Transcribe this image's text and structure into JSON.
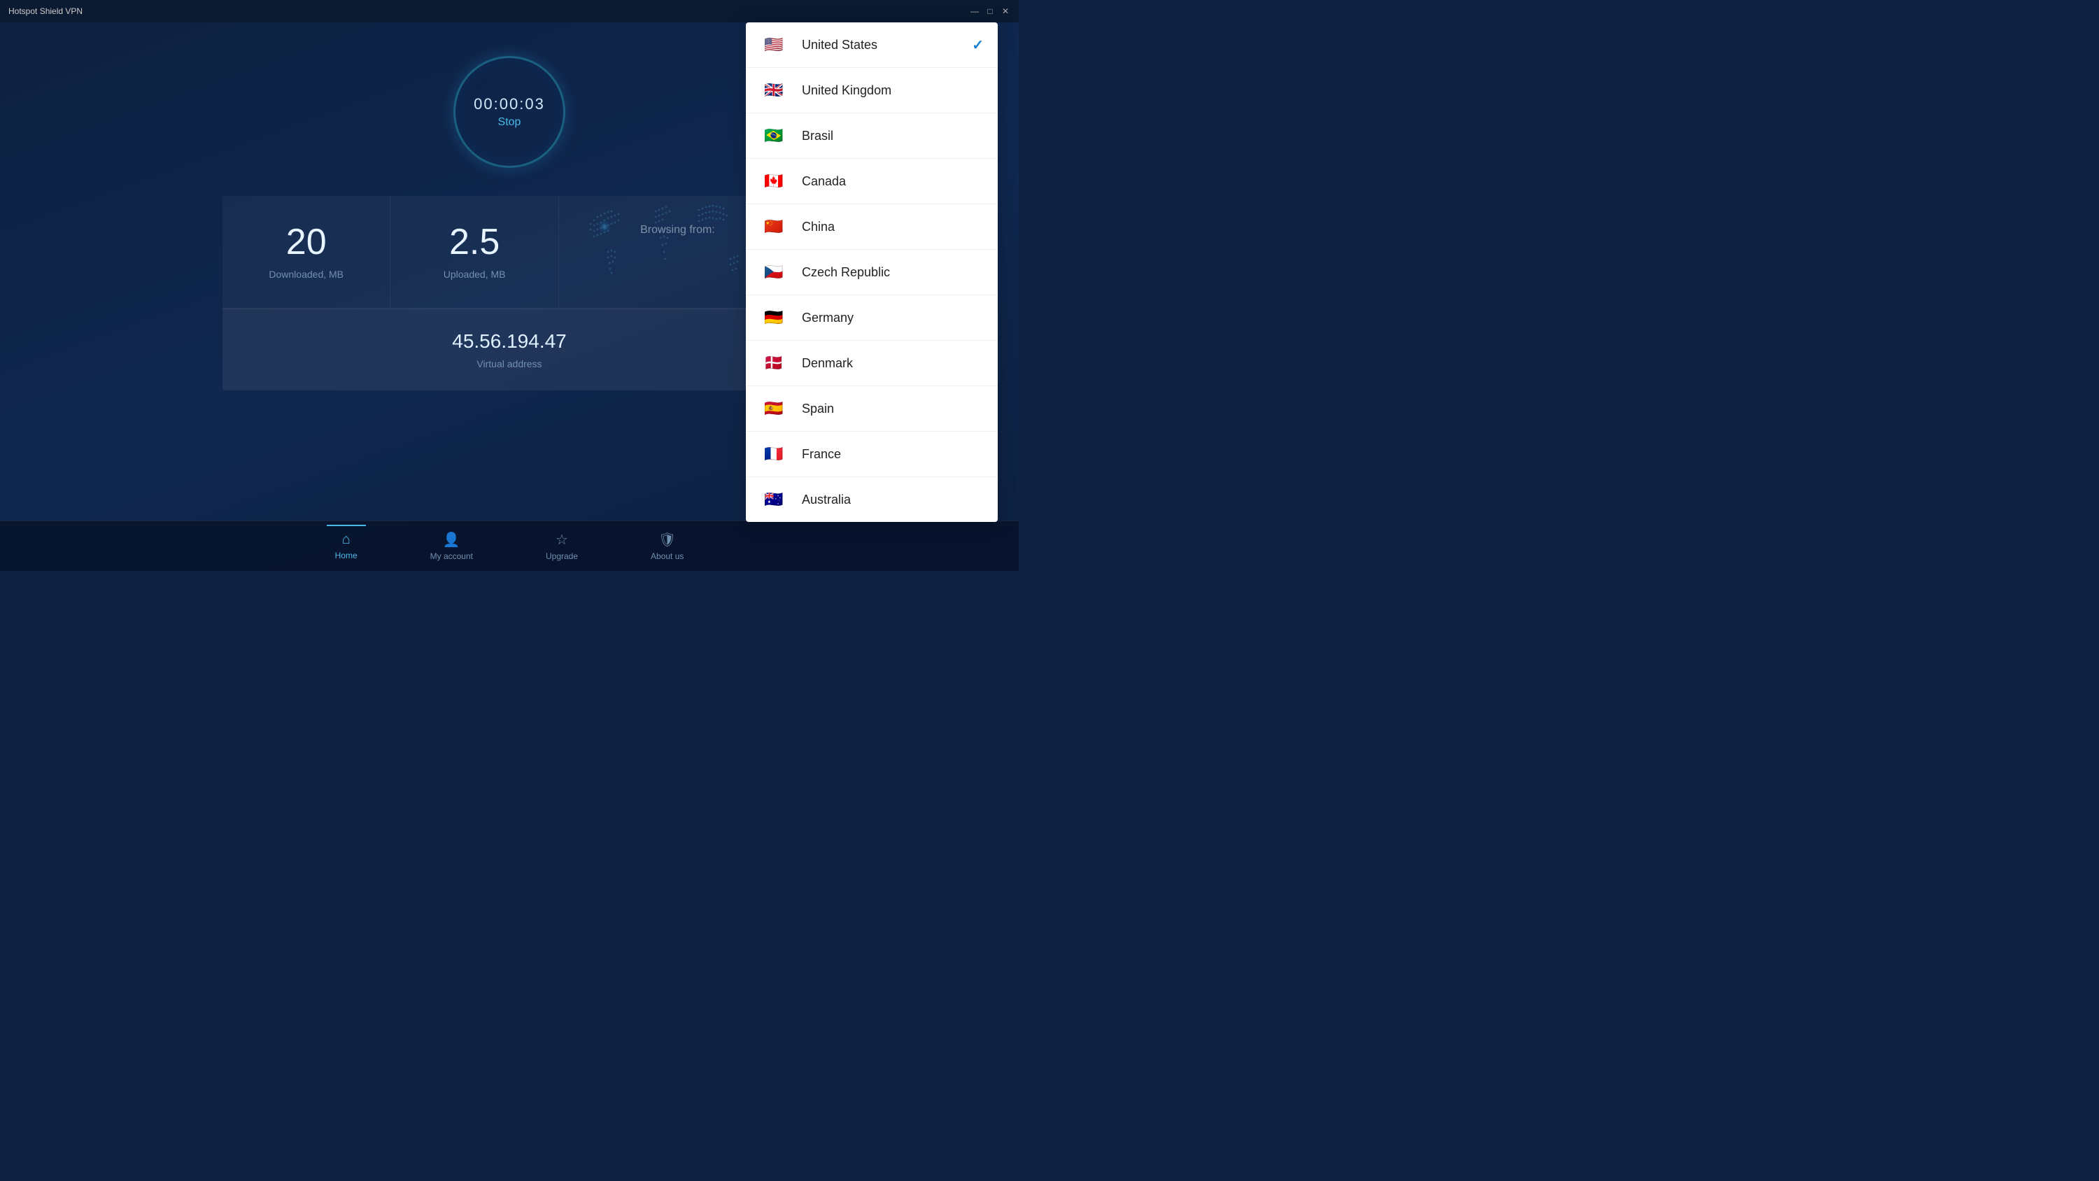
{
  "app": {
    "title": "Hotspot Shield VPN"
  },
  "titlebar": {
    "minimize": "—",
    "maximize": "□",
    "close": "✕"
  },
  "timer": {
    "value": "00:00:03",
    "stop_label": "Stop"
  },
  "stats": {
    "downloaded_value": "20",
    "downloaded_label": "Downloaded, MB",
    "uploaded_value": "2.5",
    "uploaded_label": "Uploaded, MB"
  },
  "browsing": {
    "label": "Browsing from:"
  },
  "address": {
    "ip": "45.56.194.47",
    "label": "Virtual address"
  },
  "nav": {
    "home_label": "Home",
    "account_label": "My account",
    "upgrade_label": "Upgrade",
    "about_label": "About us"
  },
  "dropdown": {
    "countries": [
      {
        "id": "us",
        "name": "United States",
        "flag": "🇺🇸",
        "selected": true
      },
      {
        "id": "gb",
        "name": "United Kingdom",
        "flag": "🇬🇧",
        "selected": false
      },
      {
        "id": "br",
        "name": "Brasil",
        "flag": "🇧🇷",
        "selected": false
      },
      {
        "id": "ca",
        "name": "Canada",
        "flag": "🇨🇦",
        "selected": false
      },
      {
        "id": "cn",
        "name": "China",
        "flag": "🇨🇳",
        "selected": false
      },
      {
        "id": "cz",
        "name": "Czech Republic",
        "flag": "🇨🇿",
        "selected": false
      },
      {
        "id": "de",
        "name": "Germany",
        "flag": "🇩🇪",
        "selected": false
      },
      {
        "id": "dk",
        "name": "Denmark",
        "flag": "🇩🇰",
        "selected": false
      },
      {
        "id": "es",
        "name": "Spain",
        "flag": "🇪🇸",
        "selected": false
      },
      {
        "id": "fr",
        "name": "France",
        "flag": "🇫🇷",
        "selected": false
      },
      {
        "id": "au",
        "name": "Australia",
        "flag": "🇦🇺",
        "selected": false
      }
    ]
  }
}
